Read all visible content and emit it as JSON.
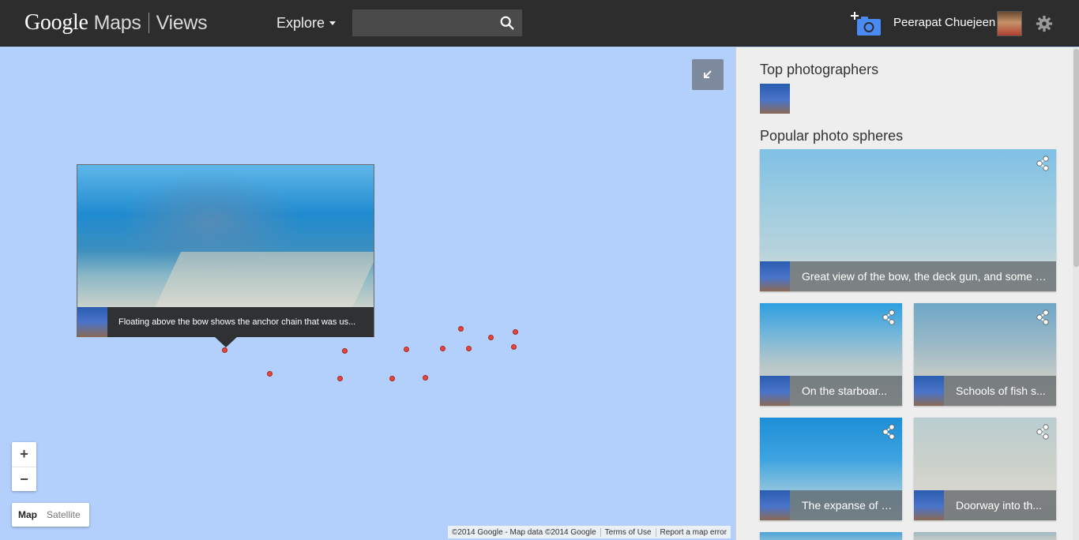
{
  "header": {
    "logo_google": "Google",
    "logo_maps": "Maps",
    "logo_views": "Views",
    "explore_label": "Explore",
    "search_value": "",
    "user_name": "Peerapat Chuejeen"
  },
  "map": {
    "popup_caption": "Floating above the bow shows the anchor chain that was us...",
    "zoom_in": "+",
    "zoom_out": "−",
    "map_type_map": "Map",
    "map_type_satellite": "Satellite",
    "attribution": "©2014 Google - Map data ©2014 Google",
    "terms": "Terms of Use",
    "report": "Report a map error"
  },
  "panel": {
    "top_photographers_title": "Top photographers",
    "popular_title": "Popular photo spheres",
    "spheres": [
      {
        "caption": "Great view of the bow, the deck gun, and some o..."
      },
      {
        "caption": "On the starboar..."
      },
      {
        "caption": "Schools of fish s..."
      },
      {
        "caption": "The expanse of t..."
      },
      {
        "caption": "Doorway into th..."
      }
    ]
  },
  "colors": {
    "header_bg": "#2d2d2d",
    "map_water": "#b3cffc",
    "marker": "#e8453c",
    "camera_accent": "#4a8af4"
  }
}
